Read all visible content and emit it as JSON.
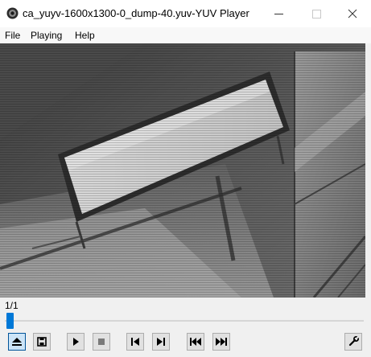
{
  "window": {
    "title": "ca_yuyv-1600x1300-0_dump-40.yuv-YUV Player",
    "minimize_icon": "minimize-icon",
    "maximize_icon": "maximize-icon",
    "close_icon": "close-icon"
  },
  "menu": {
    "items": [
      {
        "label": "File"
      },
      {
        "label": "Playing"
      },
      {
        "label": "Help"
      }
    ]
  },
  "player": {
    "frame_counter": "1/1",
    "seek_progress": 0
  },
  "controls": {
    "buttons": [
      {
        "icon": "eject-icon"
      },
      {
        "icon": "save-icon"
      },
      {
        "icon": "play-icon"
      },
      {
        "icon": "stop-icon"
      },
      {
        "icon": "step-back-icon"
      },
      {
        "icon": "step-forward-icon"
      },
      {
        "icon": "skip-to-start-icon"
      },
      {
        "icon": "skip-to-end-icon"
      },
      {
        "icon": "wrench-icon"
      }
    ]
  },
  "colors": {
    "accent": "#0078d7",
    "titlebar": "#ffffff",
    "window_bg": "#f0f0f0"
  }
}
